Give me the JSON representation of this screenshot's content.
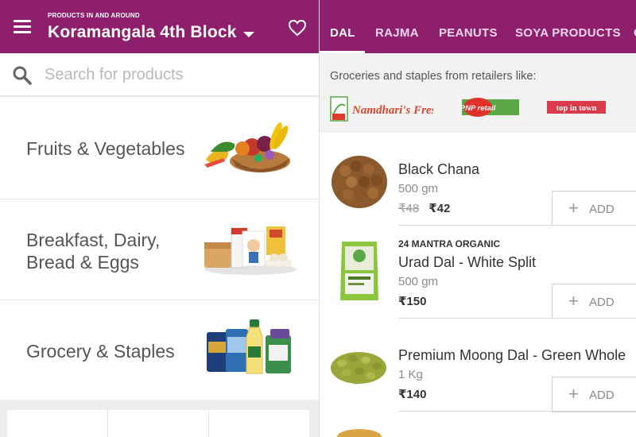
{
  "left": {
    "header": {
      "location_caption": "PRODUCTS IN AND AROUND",
      "location_name": "Koramangala 4th Block"
    },
    "search": {
      "placeholder": "Search for products"
    },
    "categories": [
      {
        "label": "Fruits & Vegetables"
      },
      {
        "label": "Breakfast, Dairy, Bread & Eggs"
      },
      {
        "label": "Grocery & Staples"
      }
    ]
  },
  "right": {
    "tabs": [
      {
        "label": "DAL",
        "active": true
      },
      {
        "label": "RAJMA"
      },
      {
        "label": "PEANUTS"
      },
      {
        "label": "SOYA PRODUCTS"
      },
      {
        "label": "C"
      }
    ],
    "retail": {
      "title": "Groceries and staples from retailers like:",
      "retailers": [
        "Namdhari's Fresh",
        "PNP retail",
        "top in town"
      ]
    },
    "products": [
      {
        "brand": "",
        "name": "Black Chana",
        "size": "500 gm",
        "old_price": "₹48",
        "price": "₹42",
        "add_label": "ADD"
      },
      {
        "brand": "24 MANTRA ORGANIC",
        "name": "Urad Dal - White Split",
        "size": "500 gm",
        "old_price": "",
        "price": "₹150",
        "add_label": "ADD"
      },
      {
        "brand": "",
        "name": "Premium Moong Dal - Green Whole",
        "size": "1 Kg",
        "old_price": "",
        "price": "₹140",
        "add_label": "ADD"
      }
    ]
  },
  "colors": {
    "brand": "#8e1f6d",
    "retail_bg": "#f2f2f2"
  }
}
